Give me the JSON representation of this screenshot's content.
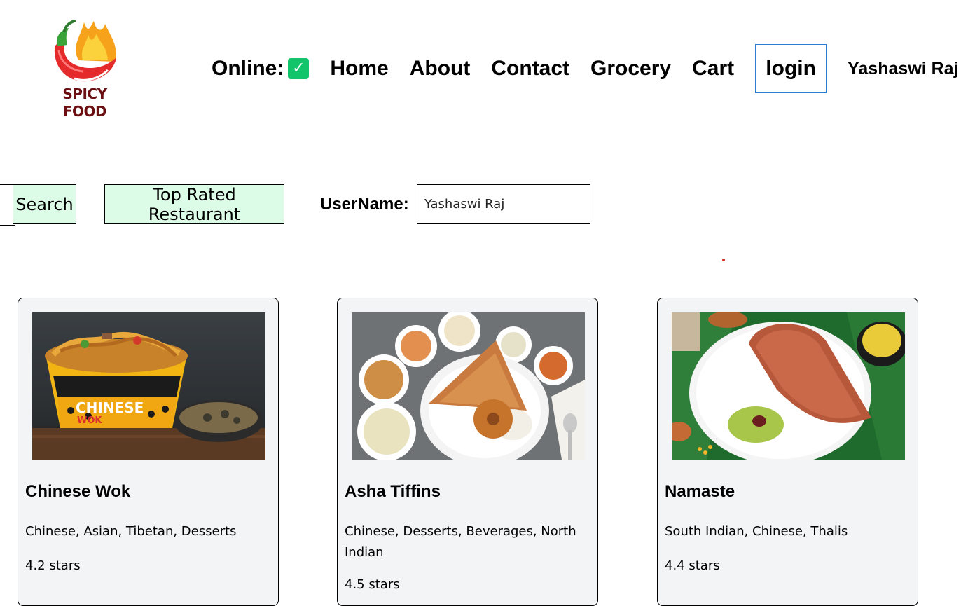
{
  "logo": {
    "line1": "SPICY",
    "line2": "FOOD"
  },
  "nav": {
    "online_label": "Online:",
    "online_status_icon": "checkmark-icon",
    "links": [
      "Home",
      "About",
      "Contact",
      "Grocery",
      "Cart"
    ],
    "login_label": "login",
    "user_name": "Yashaswi Raj"
  },
  "toolbar": {
    "search_value": "",
    "search_label": "Search",
    "top_rated_label": "Top Rated Restaurant",
    "username_label": "UserName:",
    "username_value": "Yashaswi Raj"
  },
  "restaurants": [
    {
      "name": "Chinese Wok",
      "cuisines": "Chinese, Asian, Tibetan, Desserts",
      "rating": "4.2 stars"
    },
    {
      "name": "Asha Tiffins",
      "cuisines": "Chinese, Desserts, Beverages, North Indian",
      "rating": "4.5 stars"
    },
    {
      "name": "Namaste",
      "cuisines": "South Indian, Chinese, Thalis",
      "rating": "4.4 stars"
    }
  ],
  "colors": {
    "button_bg": "#dcfce7",
    "card_bg": "#f3f4f6",
    "online_green": "#12c56b",
    "login_border": "#2b7cd3"
  }
}
